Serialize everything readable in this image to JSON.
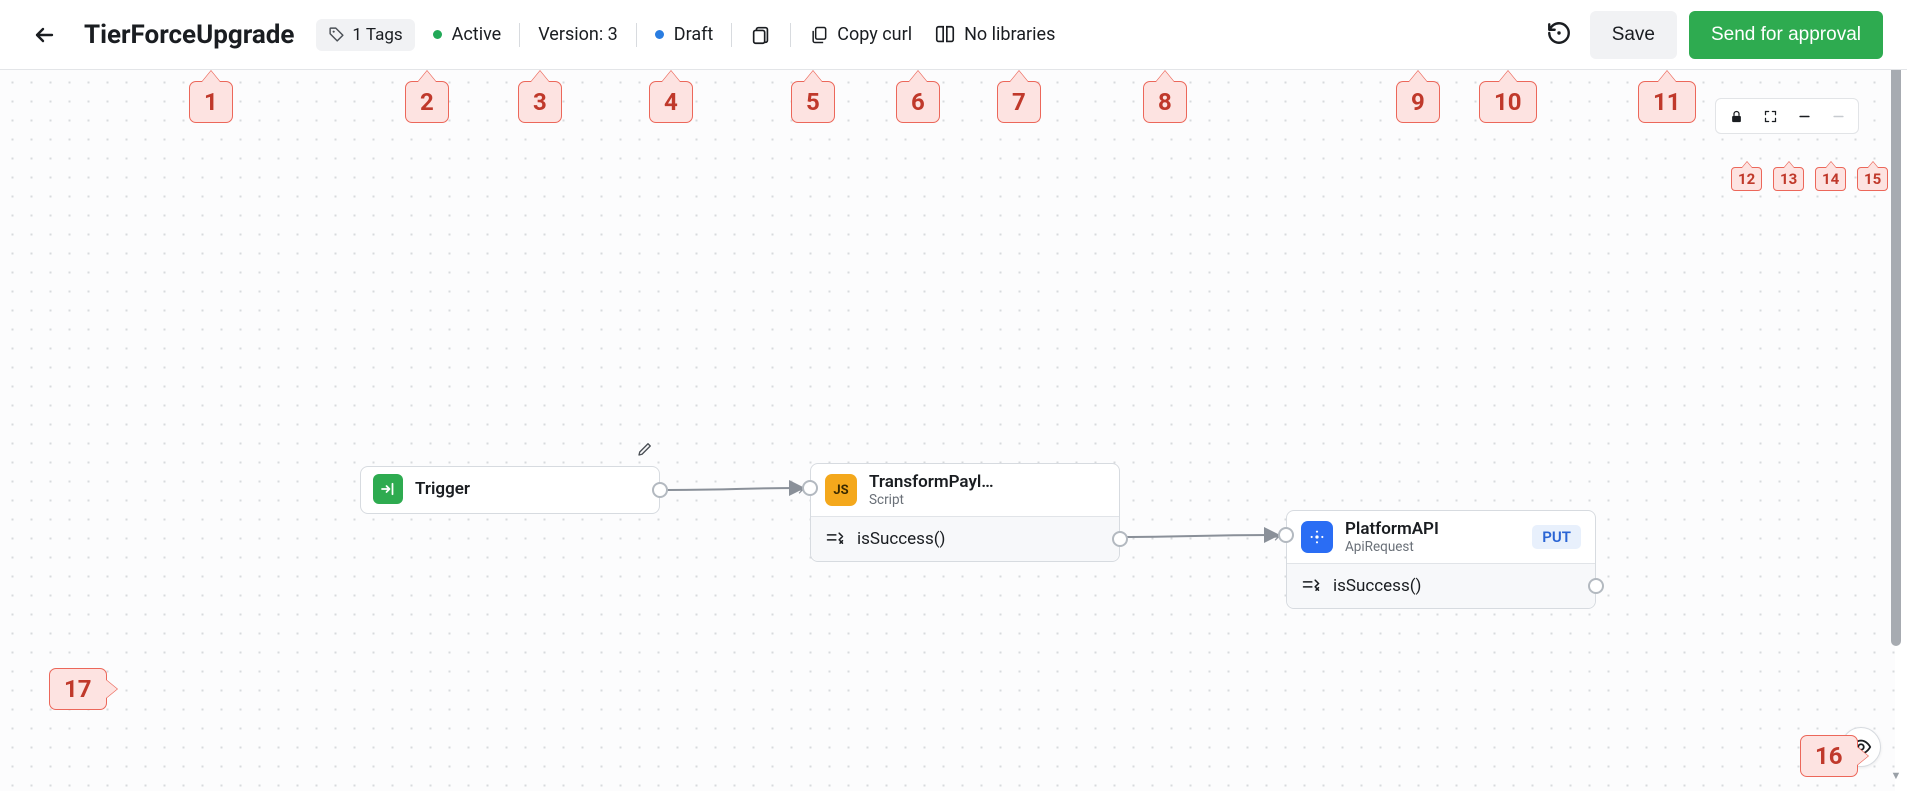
{
  "header": {
    "title": "TierForceUpgrade",
    "tags_label": "1 Tags",
    "status_label": "Active",
    "version_label": "Version: 3",
    "draft_label": "Draft",
    "copy_curl": "Copy curl",
    "no_libraries": "No libraries",
    "save_label": "Save",
    "approve_label": "Send for approval"
  },
  "nodes": {
    "trigger": {
      "title": "Trigger"
    },
    "script": {
      "title": "TransformPayl…",
      "subtitle": "Script",
      "icon_text": "JS",
      "condition": "isSuccess()"
    },
    "api": {
      "title": "PlatformAPI",
      "subtitle": "ApiRequest",
      "method": "PUT",
      "condition": "isSuccess()"
    }
  },
  "markers": {
    "m1": "1",
    "m2": "2",
    "m3": "3",
    "m4": "4",
    "m5": "5",
    "m6": "6",
    "m7": "7",
    "m8": "8",
    "m9": "9",
    "m10": "10",
    "m11": "11",
    "m12": "12",
    "m13": "13",
    "m14": "14",
    "m15": "15",
    "m16": "16",
    "m17": "17"
  },
  "colors": {
    "accent_green": "#2eab50",
    "accent_blue": "#2a7de1",
    "node_js": "#f4a81c",
    "node_api": "#2a6df4"
  }
}
